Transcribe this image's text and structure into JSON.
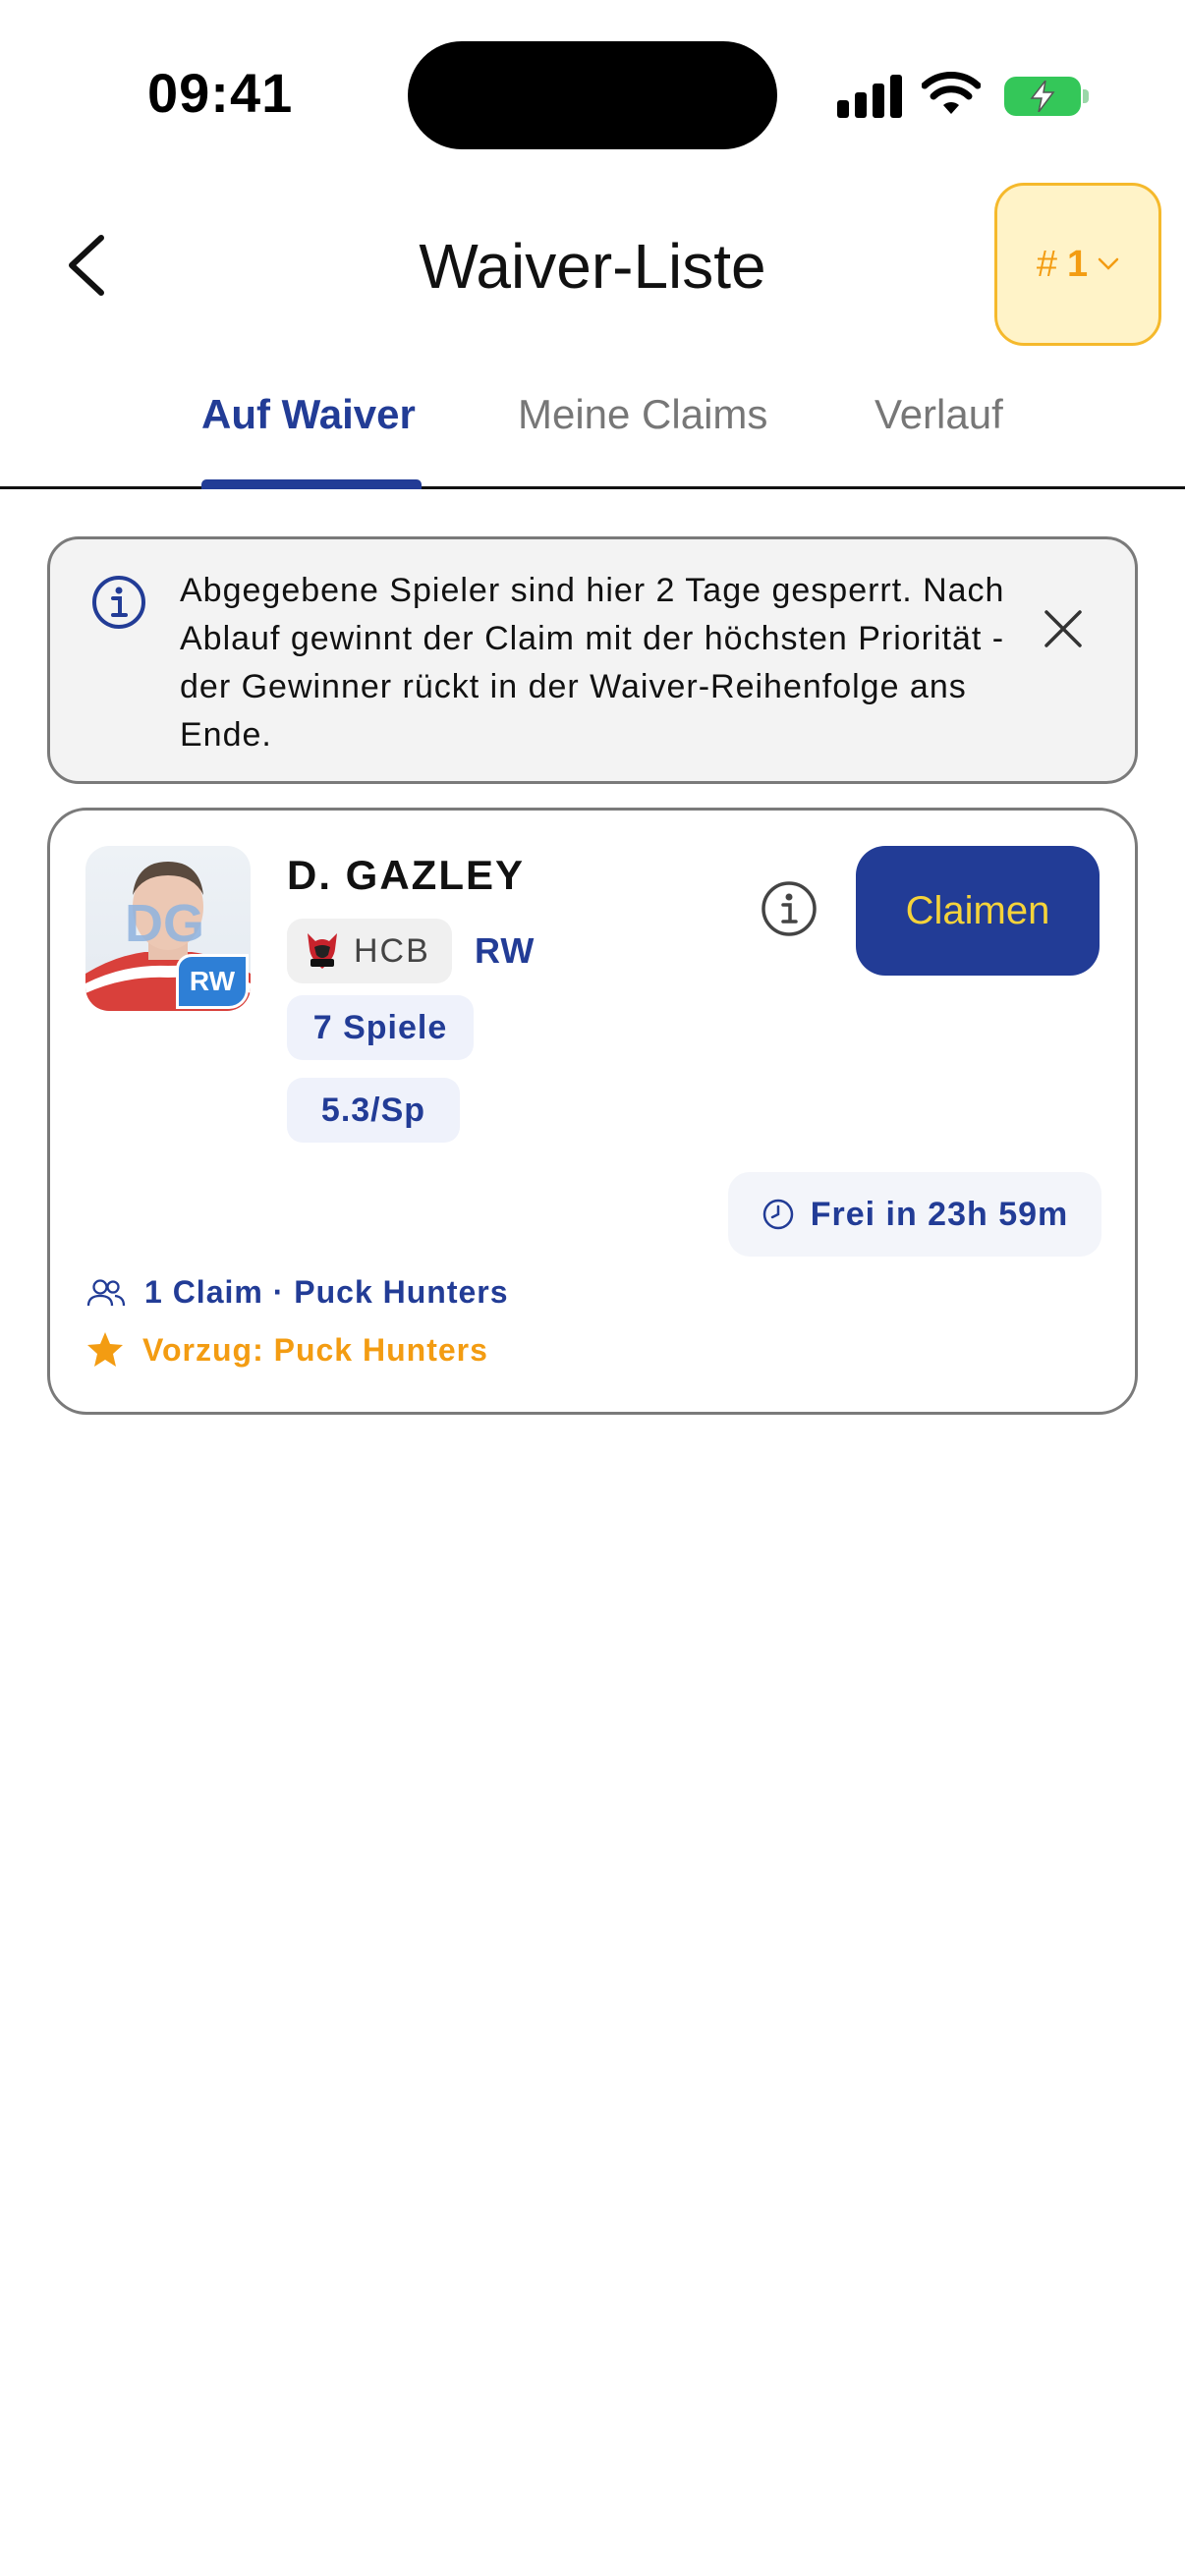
{
  "status_bar": {
    "time": "09:41"
  },
  "header": {
    "title": "Waiver-Liste",
    "rank_badge": {
      "hash": "#",
      "value": "1"
    }
  },
  "tabs": [
    {
      "label": "Auf Waiver",
      "active": true
    },
    {
      "label": "Meine Claims",
      "active": false
    },
    {
      "label": "Verlauf",
      "active": false
    }
  ],
  "info_banner": {
    "text": "Abgegebene Spieler sind hier 2 Tage gesperrt. Nach Ablauf gewinnt der Claim mit der höchsten Priorität - der Gewinner rückt in der Waiver-Reihenfolge ans Ende."
  },
  "player": {
    "initials": "DG",
    "position_badge": "RW",
    "name": "D. GAZLEY",
    "team": "HCB",
    "position": "RW",
    "games": "7 Spiele",
    "average": "5.3/Sp",
    "claim_label": "Claimen",
    "free_in": "Frei in 23h 59m",
    "claims_summary": "1 Claim · Puck Hunters",
    "preference": "Vorzug: Puck Hunters"
  },
  "colors": {
    "primary": "#223c96",
    "accent_yellow": "#f5d33a",
    "accent_orange": "#f39c12",
    "badge_background": "#fff3c8",
    "battery_green": "#34c759"
  }
}
